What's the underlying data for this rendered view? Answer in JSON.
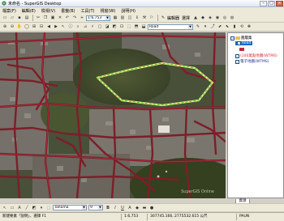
{
  "window": {
    "title": "未命名 - SuperGIS Desktop"
  },
  "menu": [
    "檔案(F)",
    "編輯(E)",
    "檢視(V)",
    "書籤(B)",
    "工具(T)",
    "視窗(W)",
    "說明(H)"
  ],
  "toolbar1": {
    "scale": "1:6,753",
    "editor_label": "編輯器",
    "editor_sel": "選擇"
  },
  "toolbar2": {
    "layer": "Road"
  },
  "toc": {
    "root": "圖層集",
    "layers": [
      {
        "label": "Road",
        "checked": true,
        "selected": true,
        "color": "#1b6ac9"
      },
      {
        "label": "(100萬點地圖(WTMS)",
        "checked": true,
        "color": "#d83030"
      },
      {
        "label": "電子地圖(WTMS)",
        "checked": true,
        "color": "#2c2c8c"
      }
    ],
    "tab_label": "資源"
  },
  "drawbar": {
    "font": "Tahoma",
    "size": "9"
  },
  "map": {
    "watermark": "SuperGIS Online"
  },
  "status": {
    "hint": "新建要素「說明」、選擇 F1",
    "scale": "1:6,753",
    "coords": "307745.166, 2775532.615 公尺",
    "mode": "PAUN"
  }
}
